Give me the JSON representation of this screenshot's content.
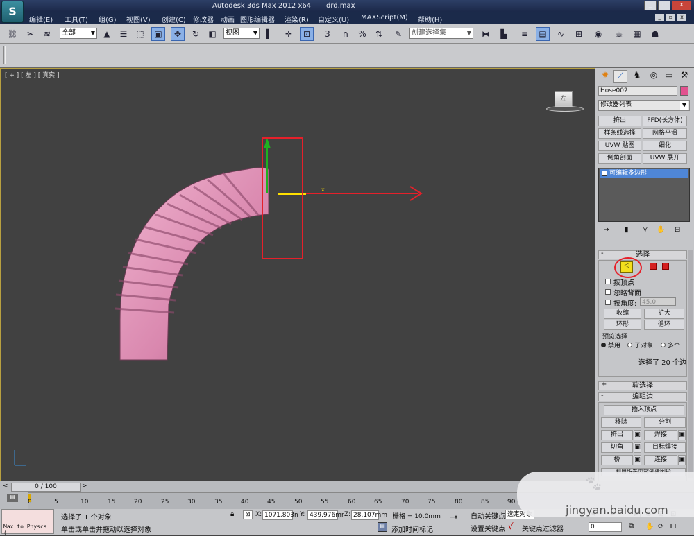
{
  "title": {
    "app": "Autodesk 3ds Max  2012 x64",
    "file": "drd.max"
  },
  "menu": [
    "编辑(E)",
    "工具(T)",
    "组(G)",
    "视图(V)",
    "创建(C)",
    "修改器",
    "动画",
    "图形编辑器",
    "渲染(R)",
    "自定义(U)",
    "MAXScript(M)",
    "帮助(H)"
  ],
  "toolbar": {
    "filter": "全部",
    "refcoord": "视图",
    "selset": "创建选择集"
  },
  "viewport": {
    "label": "[ + ] [ 左 ] [ 真实 ]",
    "viewcube": "左"
  },
  "panel": {
    "object_name": "Hose002",
    "modifier_list": "修改器列表",
    "buttons": [
      "挤出",
      "FFD(长方体)",
      "样条线选择",
      "网格平滑",
      "UVW 贴图",
      "细化",
      "倒角剖面",
      "UVW 展开"
    ],
    "stack_item": "可编辑多边形",
    "select": {
      "title": "选择",
      "by_vertex": "按顶点",
      "ignore_backface": "忽略背面",
      "by_angle": "按角度:",
      "angle": "45.0",
      "shrink": "收缩",
      "grow": "扩大",
      "ring": "环形",
      "loop": "循环",
      "preview": "预览选择",
      "off": "禁用",
      "subobj": "子对象",
      "multi": "多个",
      "status": "选择了 20 个边"
    },
    "soft": "软选择",
    "edit_edges": "编辑边",
    "insert_vertex": "插入顶点",
    "remove": "移除",
    "split": "分割",
    "extrude": "挤出",
    "weld": "焊接",
    "chamfer": "切角",
    "target_weld": "目标焊接",
    "bridge": "桥",
    "connect": "连接",
    "create_shape": "利用所选内容创建图形"
  },
  "timeline": {
    "slider": "0 / 100",
    "ticks": [
      "0",
      "5",
      "10",
      "15",
      "20",
      "25",
      "30",
      "35",
      "40",
      "45",
      "50",
      "55",
      "60",
      "65",
      "70",
      "75",
      "80",
      "85",
      "90"
    ]
  },
  "status": {
    "script": "Max to Physcs (",
    "selected": "选择了 1 个对象",
    "prompt": "单击或单击并拖动以选择对象",
    "x_label": "X:",
    "x": "1071.803n",
    "y_label": "Y:",
    "y": "439.976mr",
    "z_label": "Z:",
    "z": "28.107mm",
    "grid": "栅格 = 10.0mm",
    "add_time_tag": "添加时间标记",
    "auto_key": "自动关键点",
    "set_key": "设置关键点",
    "sel_obj": "选定对象",
    "key_filter": "关键点过滤器",
    "frame": "0"
  },
  "watermark": "jingyan.baidu.com"
}
